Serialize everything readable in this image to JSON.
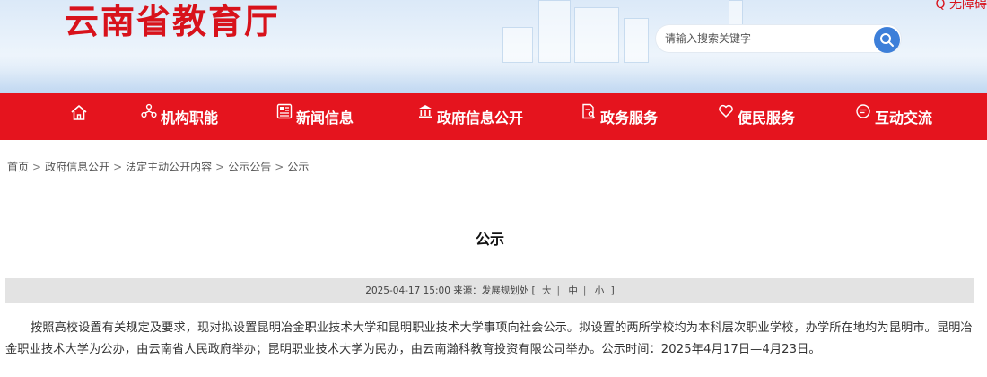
{
  "header": {
    "site_title": "云南省教育厅",
    "top_link": "Q 无障碍",
    "search_placeholder": "请输入搜索关键字"
  },
  "nav": {
    "items": [
      {
        "label": "",
        "icon": "home-icon"
      },
      {
        "label": "机构职能",
        "icon": "org-icon"
      },
      {
        "label": "新闻信息",
        "icon": "news-icon"
      },
      {
        "label": "政府信息公开",
        "icon": "gov-building-icon"
      },
      {
        "label": "政务服务",
        "icon": "service-icon"
      },
      {
        "label": "便民服务",
        "icon": "heart-hands-icon"
      },
      {
        "label": "互动交流",
        "icon": "chat-icon"
      }
    ]
  },
  "breadcrumb": {
    "items": [
      "首页",
      "政府信息公开",
      "法定主动公开内容",
      "公示公告",
      "公示"
    ],
    "separator": ">"
  },
  "article": {
    "title": "公示",
    "meta": "2025-04-17 15:00 来源：发展规划处 [",
    "size_large": "大",
    "size_medium": "中",
    "size_small": "小",
    "meta_end": "]",
    "body": "按照高校设置有关规定及要求，现对拟设置昆明冶金职业技术大学和昆明职业技术大学事项向社会公示。拟设置的两所学校均为本科层次职业学校，办学所在地均为昆明市。昆明冶金职业技术大学为公办，由云南省人民政府举办；昆明职业技术大学为民办，由云南瀚科教育投资有限公司举办。公示时间：2025年4月17日—4月23日。"
  },
  "colors": {
    "brand_red": "#e5141e",
    "title_red": "#d8121b",
    "search_blue": "#3d7fd9",
    "meta_bg": "#e3e3e3"
  }
}
